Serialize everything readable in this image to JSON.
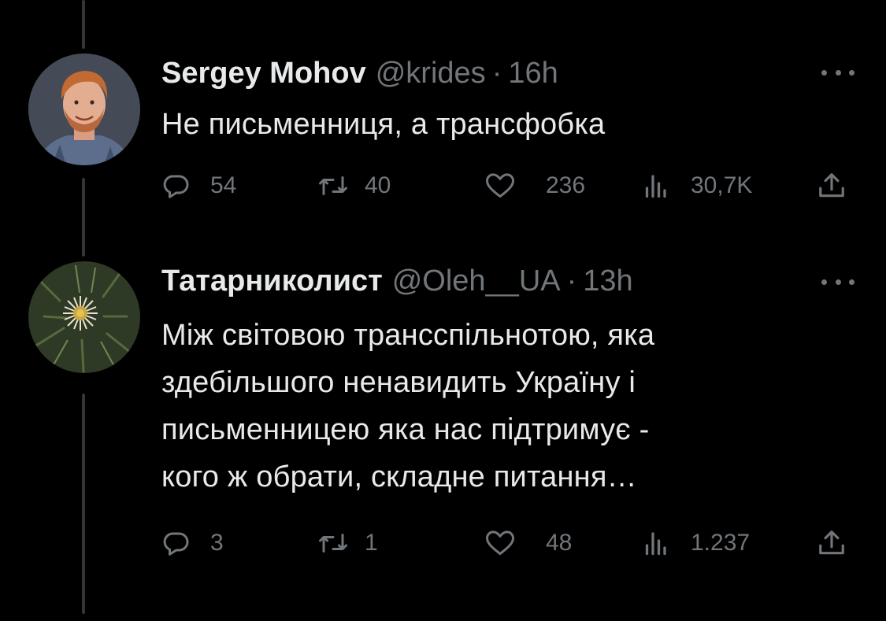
{
  "tweets": [
    {
      "author_name": "Sergey Mohov",
      "handle": "@krides",
      "separator": "·",
      "time": "16h",
      "text_lines": [
        "Не письменниця, а трансфобка"
      ],
      "stats": {
        "replies": "54",
        "retweets": "40",
        "likes": "236",
        "views": "30,7K"
      }
    },
    {
      "author_name": "Татарниколист",
      "handle": "@Oleh__UA",
      "separator": "·",
      "time": "13h",
      "text_lines": [
        "Між світовою трансспільнотою, яка",
        "здебільшого ненавидить Україну і",
        "письменницею яка нас підтримує -",
        "кого ж обрати, складне питання…"
      ],
      "stats": {
        "replies": "3",
        "retweets": "1",
        "likes": "48",
        "views": "1.237"
      }
    }
  ],
  "colors": {
    "background": "#000000",
    "primary_text": "#e7e9ea",
    "secondary_text": "#71767b",
    "thread_line": "#333639"
  },
  "icons": [
    "reply-icon",
    "retweet-icon",
    "like-icon",
    "views-icon",
    "share-icon",
    "more-icon"
  ]
}
